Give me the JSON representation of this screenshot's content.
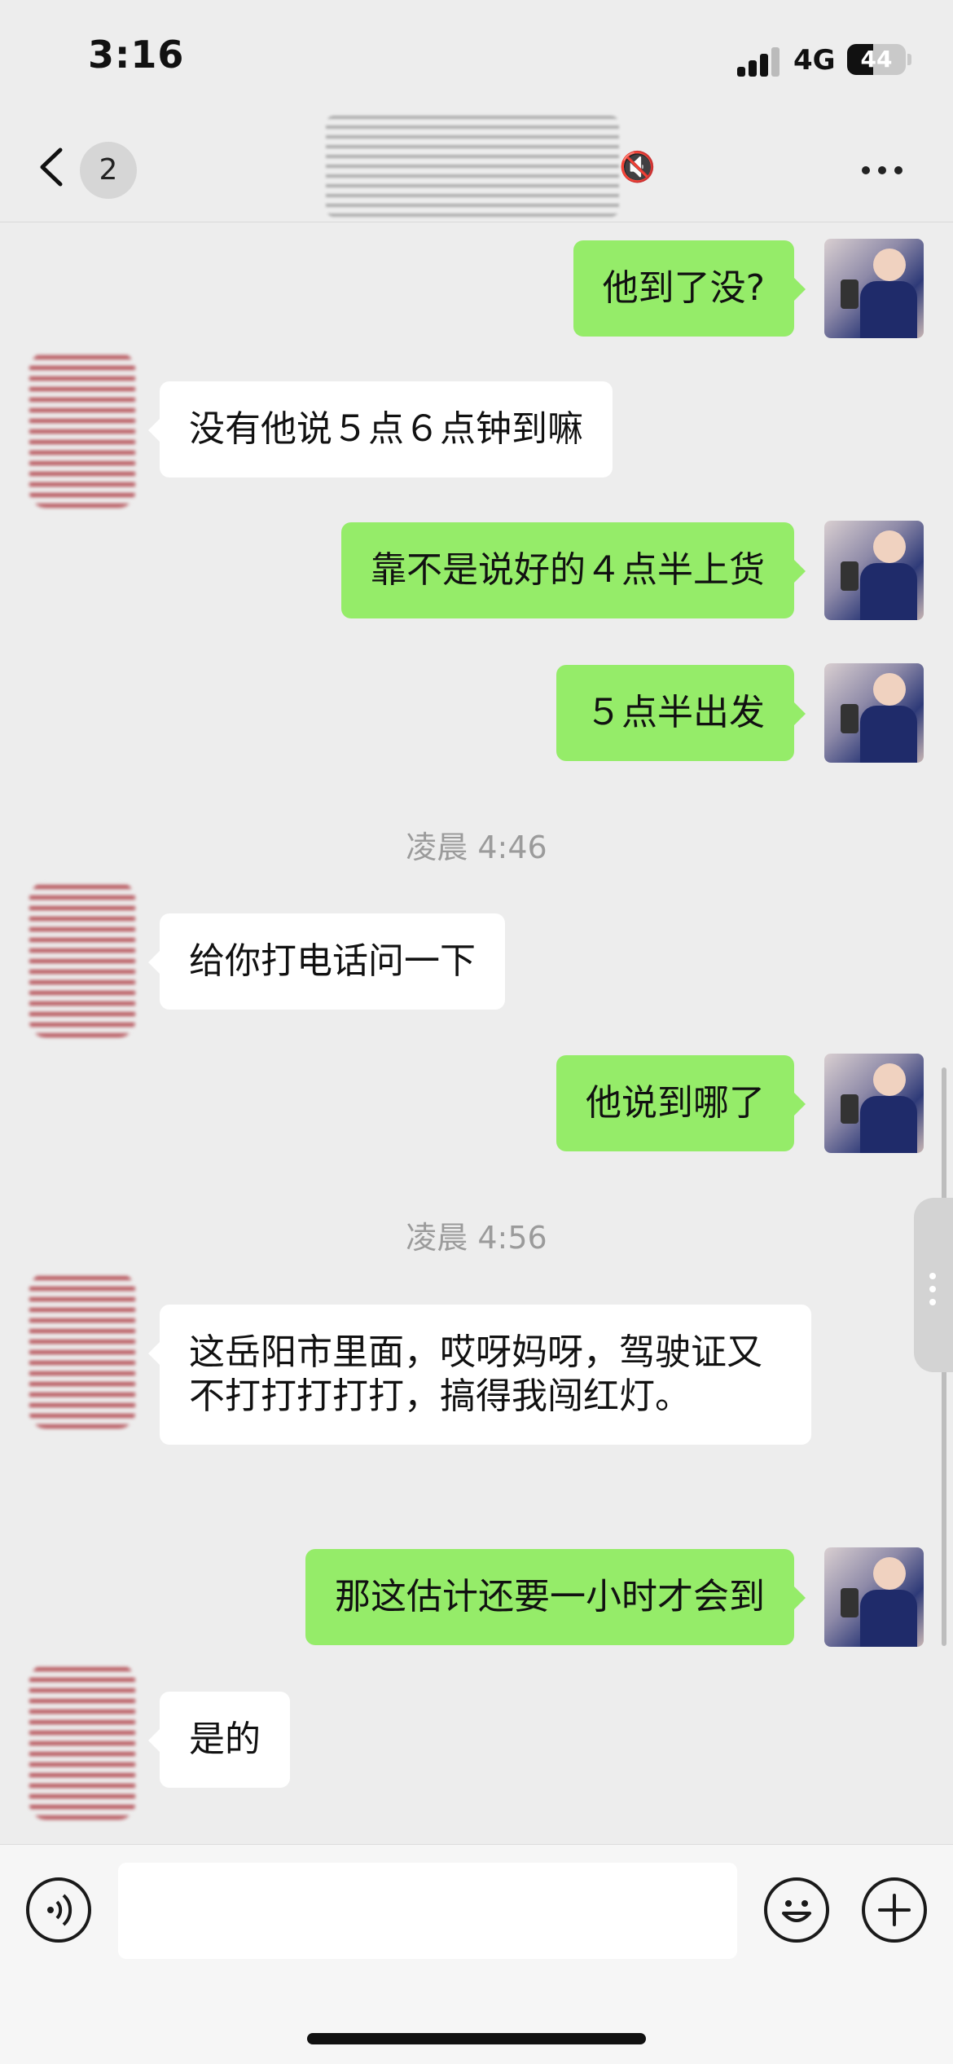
{
  "status_bar": {
    "time": "3:16",
    "network": "4G",
    "battery_level": "44"
  },
  "nav": {
    "unread_count": "2",
    "title_icons": "🔇"
  },
  "chat": {
    "messages": [
      {
        "sender": "me",
        "text": "他到了没?"
      },
      {
        "sender": "them",
        "text": "没有他说５点６点钟到嘛"
      },
      {
        "sender": "me",
        "text": "靠不是说好的４点半上货"
      },
      {
        "sender": "me",
        "text": "５点半出发"
      },
      {
        "type": "timestamp",
        "text": "凌晨 4:46"
      },
      {
        "sender": "them",
        "text": "给你打电话问一下"
      },
      {
        "sender": "me",
        "text": "他说到哪了"
      },
      {
        "type": "timestamp",
        "text": "凌晨 4:56"
      },
      {
        "sender": "them",
        "text": "这岳阳市里面，哎呀妈呀，驾驶证又不打打打打打，搞得我闯红灯。"
      },
      {
        "sender": "me",
        "text": "那这估计还要一小时才会到"
      },
      {
        "sender": "them",
        "text": "是的"
      }
    ]
  },
  "input_bar": {
    "message_value": "",
    "icons": [
      "voice-icon",
      "emoji-icon",
      "plus-icon"
    ]
  },
  "colors": {
    "background": "#ededed",
    "my_bubble": "#95ec69",
    "their_bubble": "#ffffff",
    "timestamp_text": "#9b9b9b"
  }
}
